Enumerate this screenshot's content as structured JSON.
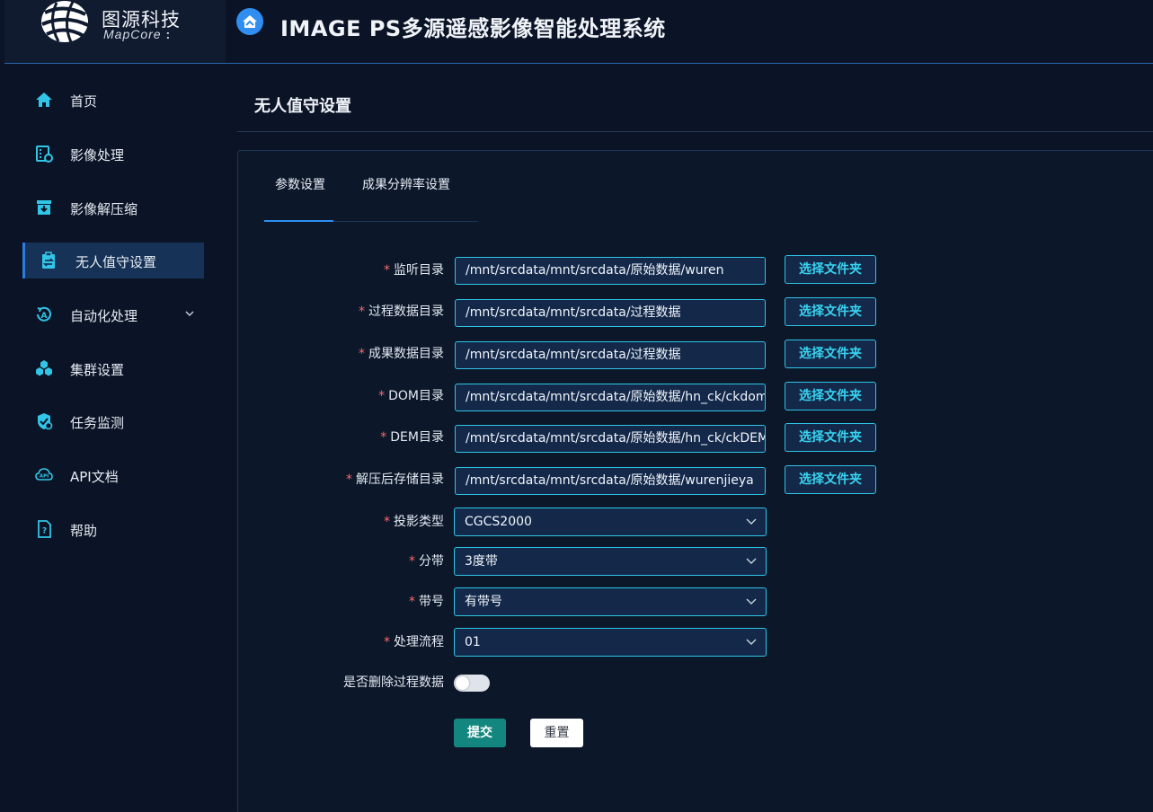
{
  "brand": {
    "name_cn": "图源科技",
    "name_en": "MapCore",
    "name_en_suffix": ":"
  },
  "app": {
    "title": "IMAGE PS多源遥感影像智能处理系统",
    "icon": "home-circle-icon"
  },
  "sidebar": {
    "items": [
      {
        "label": "首页",
        "icon": "home-icon"
      },
      {
        "label": "影像处理",
        "icon": "film-gear-icon"
      },
      {
        "label": "影像解压缩",
        "icon": "archive-download-icon"
      },
      {
        "label": "无人值守设置",
        "icon": "clipboard-sync-icon",
        "active": true
      },
      {
        "label": "自动化处理",
        "icon": "auto-cycle-icon",
        "expandable": true
      },
      {
        "label": "集群设置",
        "icon": "cluster-icon"
      },
      {
        "label": "任务监测",
        "icon": "shield-gear-icon"
      },
      {
        "label": "API文档",
        "icon": "api-cloud-icon"
      },
      {
        "label": "帮助",
        "icon": "help-doc-icon"
      }
    ]
  },
  "page": {
    "title": "无人值守设置"
  },
  "tabs": [
    {
      "label": "参数设置",
      "active": true
    },
    {
      "label": "成果分辨率设置",
      "active": false
    }
  ],
  "form": {
    "required_mark": "*",
    "pick_folder_label": "选择文件夹",
    "fields": [
      {
        "label": "监听目录",
        "value": "/mnt/srcdata/mnt/srcdata/原始数据/wuren"
      },
      {
        "label": "过程数据目录",
        "value": "/mnt/srcdata/mnt/srcdata/过程数据"
      },
      {
        "label": "成果数据目录",
        "value": "/mnt/srcdata/mnt/srcdata/过程数据"
      },
      {
        "label": "DOM目录",
        "value": "/mnt/srcdata/mnt/srcdata/原始数据/hn_ck/ckdom"
      },
      {
        "label": "DEM目录",
        "value": "/mnt/srcdata/mnt/srcdata/原始数据/hn_ck/ckDEM"
      },
      {
        "label": "解压后存储目录",
        "value": "/mnt/srcdata/mnt/srcdata/原始数据/wurenjieya"
      }
    ],
    "selects": [
      {
        "label": "投影类型",
        "value": "CGCS2000"
      },
      {
        "label": "分带",
        "value": "3度带"
      },
      {
        "label": "带号",
        "value": "有带号"
      },
      {
        "label": "处理流程",
        "value": "01"
      }
    ],
    "toggle": {
      "label": "是否删除过程数据",
      "on": false
    },
    "submit_label": "提交",
    "reset_label": "重置"
  },
  "colors": {
    "background": "#0b1426",
    "accent": "#2f8ef0",
    "input_border": "#2ec4e6",
    "submit": "#13877f",
    "required": "#f56c6c"
  }
}
